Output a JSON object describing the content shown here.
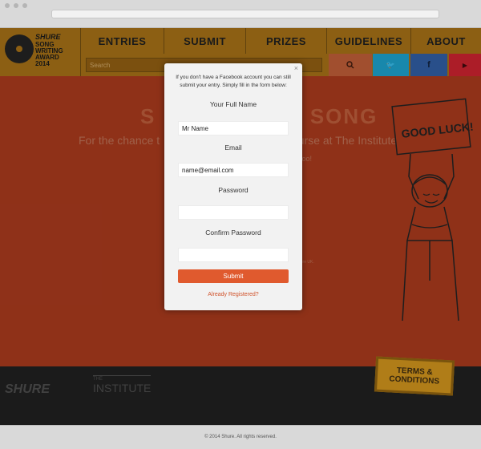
{
  "browser": {},
  "site": {
    "logo": {
      "brand": "SHURE",
      "line1": "SONG",
      "line2": "WRITING",
      "line3": "AWARD",
      "line4": "2014"
    },
    "nav": [
      {
        "label": "ENTRIES"
      },
      {
        "label": "SUBMIT"
      },
      {
        "label": "PRIZES"
      },
      {
        "label": "GUIDELINES"
      },
      {
        "label": "ABOUT"
      }
    ],
    "search": {
      "placeholder": "Search"
    },
    "social": {
      "twitter_glyph": "🐦",
      "facebook_glyph": "f",
      "youtube_glyph": "▶"
    },
    "hero": {
      "title_left": "S",
      "title_right": "SONG",
      "subtitle_left": "For the chance t",
      "subtitle_right": "course at The Institute!",
      "subtitle2": "ns too!",
      "small1": "r",
      "small2": "hure UK."
    },
    "illustration": {
      "sign_text": "GOOD LUCK!"
    },
    "footer": {
      "shure": "SHURE",
      "institute_top": "THE",
      "institute": "INSTITUTE",
      "terms": "TERMS & CONDITIONS"
    },
    "copyright": "© 2014 Shure. All rights reserved."
  },
  "modal": {
    "close_glyph": "×",
    "intro": "If you don't have a Facebook account you can still submit your entry. Simply fill in the form below:",
    "fields": [
      {
        "label": "Your Full Name",
        "value": "Mr Name",
        "placeholder": ""
      },
      {
        "label": "Email",
        "value": "name@email.com",
        "placeholder": ""
      },
      {
        "label": "Password",
        "value": "",
        "placeholder": ""
      },
      {
        "label": "Confirm Password",
        "value": "",
        "placeholder": ""
      }
    ],
    "submit_label": "Submit",
    "already_label": "Already Registered?"
  },
  "colors": {
    "background": "#a3381c",
    "nav": "#a06d16",
    "accent": "#e05a2e",
    "twitter": "#1c9bc4",
    "facebook": "#2f5a9e",
    "youtube": "#c4222e"
  }
}
